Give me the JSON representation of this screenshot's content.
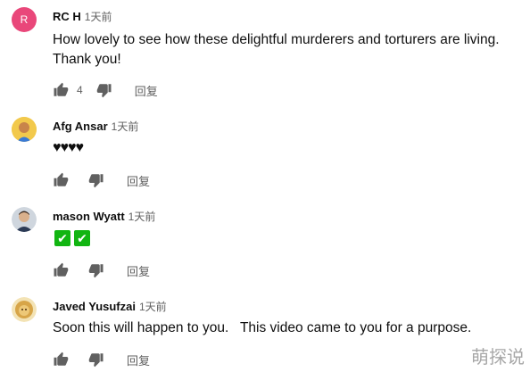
{
  "comments": [
    {
      "avatar_letter": "R",
      "avatar_color": "#e9477a",
      "author": "RC H",
      "time": "1天前",
      "text_lines": [
        "How lovely to see how these delightful murderers and torturers are living.",
        "Thank you!"
      ],
      "likes": "4",
      "reply_label": "回复"
    },
    {
      "avatar_icon": "yellow-face-avatar",
      "author": "Afg Ansar",
      "time": "1天前",
      "text": "♥♥♥♥",
      "likes": "",
      "reply_label": "回复"
    },
    {
      "avatar_icon": "man-photo-avatar",
      "author": "mason Wyatt",
      "time": "1天前",
      "text": "✓✓",
      "check_emoji": [
        "✔",
        "✔"
      ],
      "likes": "",
      "reply_label": "回复"
    },
    {
      "avatar_icon": "lion-avatar",
      "author": "Javed Yusufzai",
      "time": "1天前",
      "text": "Soon this will happen to you.   This video came to you for a purpose.",
      "likes": "",
      "reply_label": "回复"
    }
  ],
  "watermark": "萌探说"
}
